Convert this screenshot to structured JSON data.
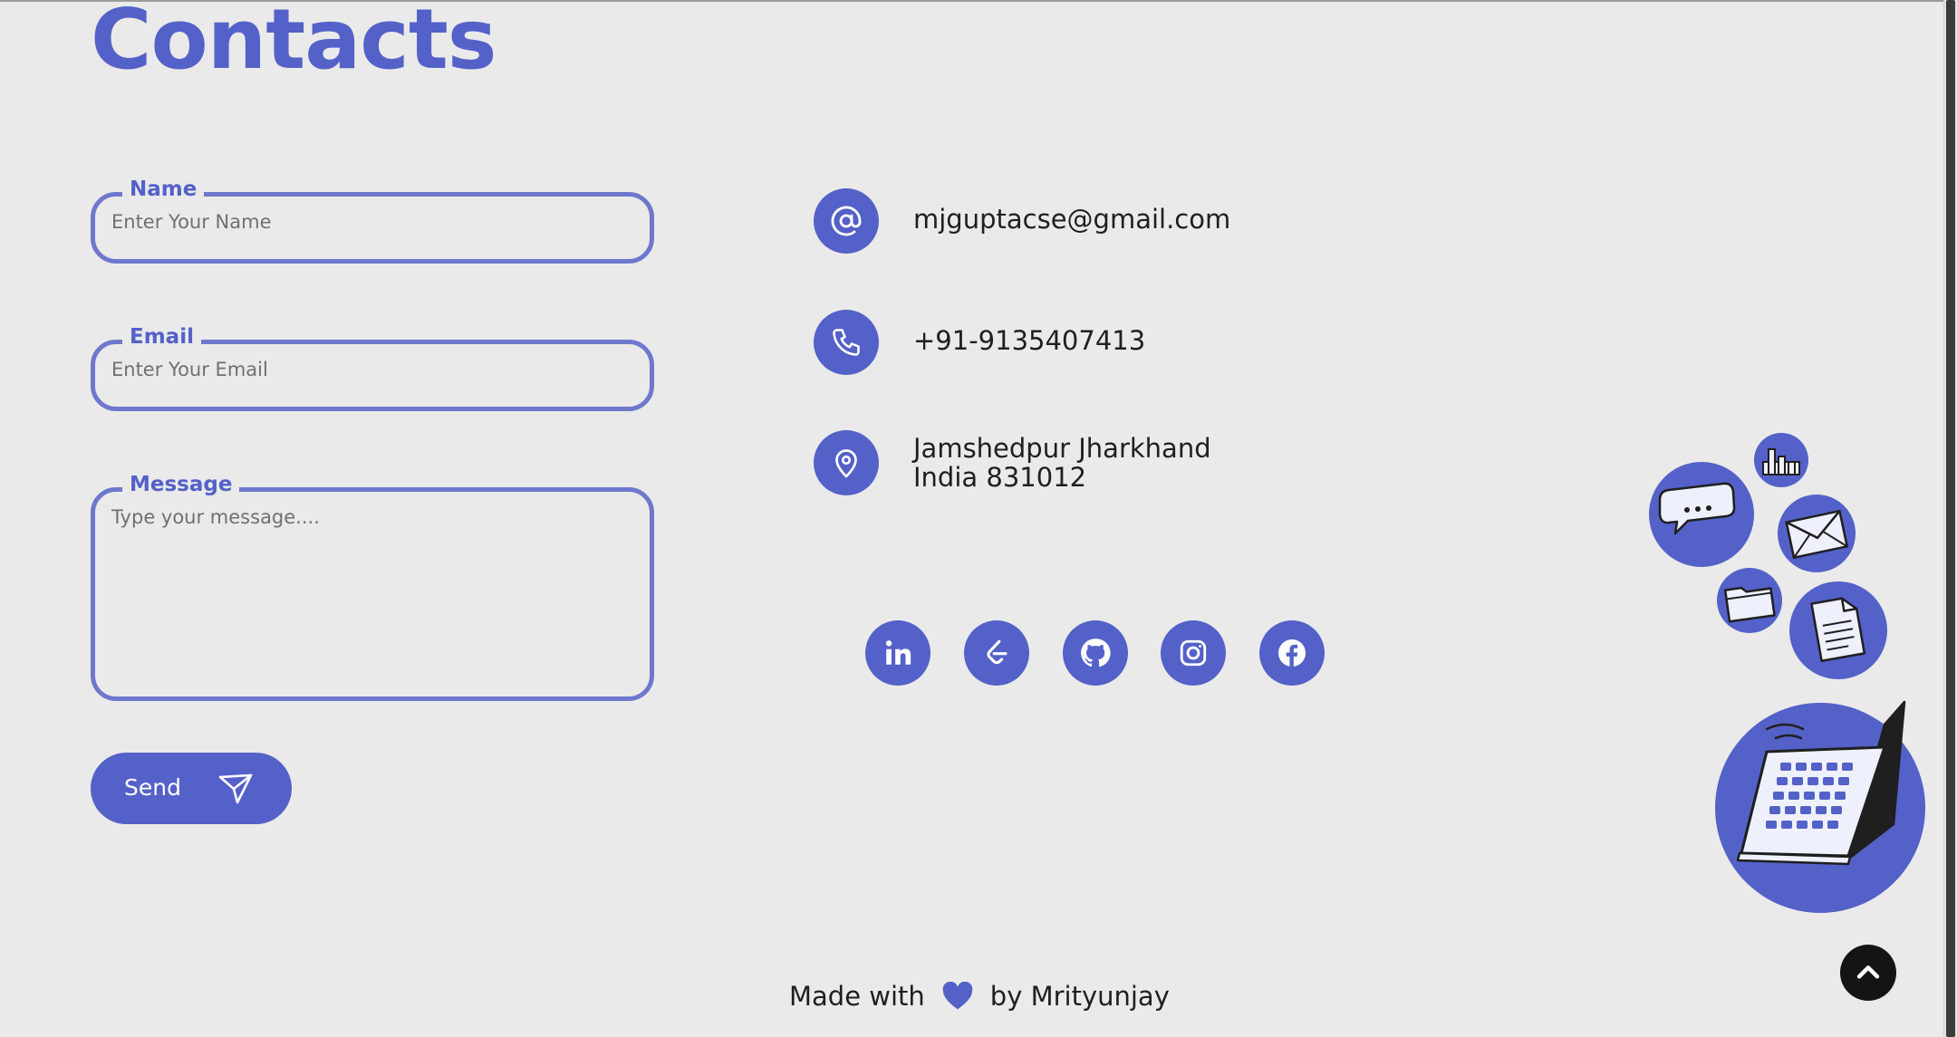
{
  "page": {
    "title": "Contacts"
  },
  "form": {
    "name_label": "Name",
    "name_placeholder": "Enter Your Name",
    "email_label": "Email",
    "email_placeholder": "Enter Your Email",
    "message_label": "Message",
    "message_placeholder": "Type your message....",
    "send_label": "Send"
  },
  "contact_info": {
    "email": "mjguptacse@gmail.com",
    "phone": "+91-9135407413",
    "address_line1": "Jamshedpur Jharkhand",
    "address_line2": "India 831012"
  },
  "social": {
    "icons": [
      "linkedin-icon",
      "leetcode-icon",
      "github-icon",
      "instagram-icon",
      "facebook-icon"
    ]
  },
  "footer": {
    "made_with": "Made with",
    "by": "by Mrityunjay"
  },
  "colors": {
    "accent": "#5461c8",
    "border": "#6e78cc",
    "background": "#eaeaea",
    "text": "#1f1f1f"
  }
}
